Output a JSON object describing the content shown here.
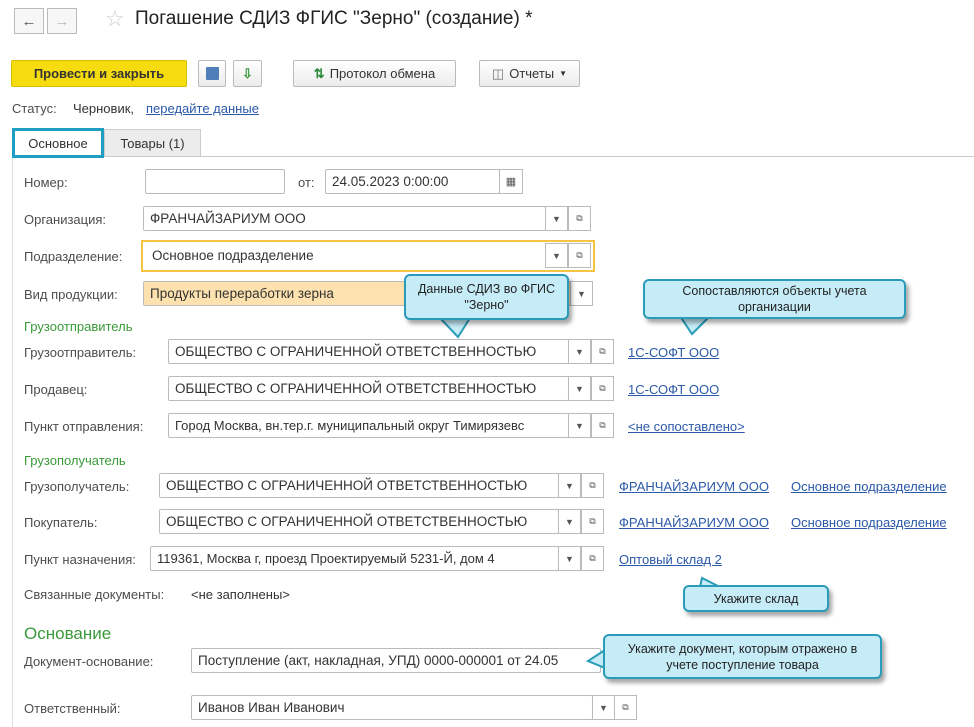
{
  "window": {
    "title": "Погашение СДИЗ ФГИС \"Зерно\" (создание) *"
  },
  "toolbar": {
    "post_close": "Провести и закрыть",
    "exchange_log": "Протокол обмена",
    "reports": "Отчеты"
  },
  "status": {
    "label": "Статус:",
    "value": "Черновик,",
    "link": "передайте данные"
  },
  "tabs": [
    {
      "label": "Основное",
      "active": true
    },
    {
      "label": "Товары (1)",
      "active": false
    }
  ],
  "form": {
    "number": {
      "label": "Номер:",
      "value": ""
    },
    "date": {
      "label": "от:",
      "value": "24.05.2023  0:00:00"
    },
    "organization": {
      "label": "Организация:",
      "value": "ФРАНЧАЙЗАРИУМ ООО"
    },
    "department": {
      "label": "Подразделение:",
      "value": "Основное подразделение"
    },
    "product_type": {
      "label": "Вид продукции:",
      "value": "Продукты переработки зерна"
    },
    "shipper_section": "Грузоотправитель",
    "shipper": {
      "label": "Грузоотправитель:",
      "value": "ОБЩЕСТВО С ОГРАНИЧЕННОЙ ОТВЕТСТВЕННОСТЬЮ",
      "link": "1С-СОФТ ООО"
    },
    "seller": {
      "label": "Продавец:",
      "value": "ОБЩЕСТВО С ОГРАНИЧЕННОЙ ОТВЕТСТВЕННОСТЬЮ",
      "link": "1С-СОФТ ООО"
    },
    "departure": {
      "label": "Пункт отправления:",
      "value": "Город Москва, вн.тер.г. муниципальный округ Тимирязевс",
      "link": "<не сопоставлено>"
    },
    "consignee_section": "Грузополучатель",
    "consignee": {
      "label": "Грузополучатель:",
      "value": "ОБЩЕСТВО С ОГРАНИЧЕННОЙ ОТВЕТСТВЕННОСТЬЮ",
      "link1": "ФРАНЧАЙЗАРИУМ ООО",
      "link2": "Основное подразделение"
    },
    "buyer": {
      "label": "Покупатель:",
      "value": "ОБЩЕСТВО С ОГРАНИЧЕННОЙ ОТВЕТСТВЕННОСТЬЮ",
      "link1": "ФРАНЧАЙЗАРИУМ ООО",
      "link2": "Основное подразделение"
    },
    "destination": {
      "label": "Пункт назначения:",
      "value": "119361, Москва г, проезд Проектируемый 5231-Й, дом 4",
      "link": "Оптовый склад 2"
    },
    "related": {
      "label": "Связанные документы:",
      "value": "<не заполнены>"
    },
    "basis_section": "Основание",
    "basis_doc": {
      "label": "Документ-основание:",
      "value": "Поступление (акт, накладная, УПД) 0000-000001 от 24.05"
    },
    "responsible": {
      "label": "Ответственный:",
      "value": "Иванов Иван Иванович"
    }
  },
  "callouts": {
    "sdiz": "Данные СДИЗ во ФГИС \"Зерно\"",
    "match": "Сопоставляются объекты учета организации",
    "warehouse": "Укажите склад",
    "document": "Укажите документ, которым отражено в учете поступление товара"
  }
}
